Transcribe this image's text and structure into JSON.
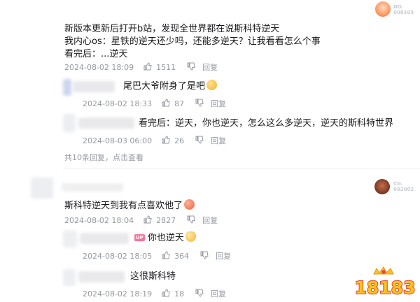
{
  "badges": [
    {
      "label": "NO.",
      "number": "008105"
    },
    {
      "label": "CG.",
      "number": "002002"
    }
  ],
  "comment1": {
    "lines": [
      "新版本更新后打开b站，发现全世界都在说斯科特逆天",
      "我内心os：星铁的逆天还少吗，还能多逆天？让我看看怎么个事",
      "看完后：...逆天"
    ],
    "date": "2024-08-02 18:09",
    "likes": "1511",
    "reply_label": "回复",
    "replies": [
      {
        "text": "尾巴大爷附身了是吧",
        "date": "2024-08-02 18:33",
        "likes": "87",
        "reply_label": "回复"
      },
      {
        "text": "看完后：逆天，你也逆天，怎么这么多逆天，逆天的斯科特世界",
        "date": "2024-08-03 06:00",
        "likes": "26",
        "reply_label": "回复"
      }
    ],
    "more": "共10条回复，点击查看"
  },
  "comment2": {
    "text": "斯科特逆天到我有点喜欢他了",
    "date": "2024-08-02 18:04",
    "likes": "2827",
    "reply_label": "回复",
    "replies": [
      {
        "up_tag": "UP",
        "text": "你也逆天",
        "date": "2024-08-02 18:05",
        "likes": "364",
        "reply_label": "回复"
      },
      {
        "text": "这很斯科特",
        "date": "2024-08-02 18:19",
        "likes": "18",
        "reply_label": "回复"
      }
    ]
  },
  "watermark": {
    "text": "18183"
  },
  "icons": [
    "thumb-up-icon",
    "thumb-down-icon",
    "laughing-emoji-icon",
    "heart-eyes-emoji-icon",
    "cat-emoji-icon"
  ]
}
